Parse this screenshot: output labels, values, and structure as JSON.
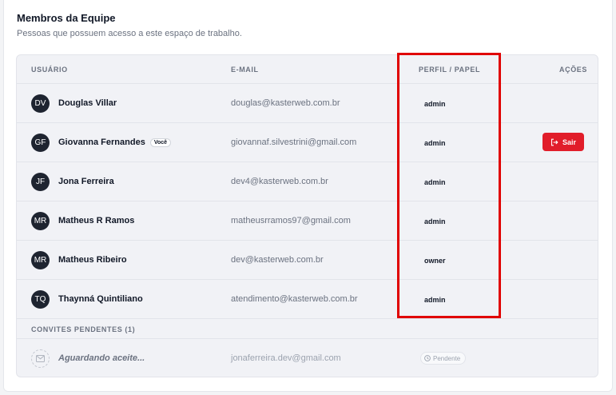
{
  "section": {
    "title": "Membros da Equipe",
    "subtitle": "Pessoas que possuem acesso a este espaço de trabalho."
  },
  "table": {
    "headers": {
      "user": "USUÁRIO",
      "email": "E-MAIL",
      "role": "PERFIL / PAPEL",
      "actions": "AÇÕES"
    },
    "members": [
      {
        "initials": "DV",
        "name": "Douglas Villar",
        "email": "douglas@kasterweb.com.br",
        "role": "admin"
      },
      {
        "initials": "GF",
        "name": "Giovanna Fernandes",
        "badge": "Você",
        "email": "giovannaf.silvestrini@gmail.com",
        "role": "admin",
        "action": "Sair"
      },
      {
        "initials": "JF",
        "name": "Jona Ferreira",
        "email": "dev4@kasterweb.com.br",
        "role": "admin"
      },
      {
        "initials": "MR",
        "name": "Matheus R Ramos",
        "email": "matheusrramos97@gmail.com",
        "role": "admin"
      },
      {
        "initials": "MR",
        "name": "Matheus Ribeiro",
        "email": "dev@kasterweb.com.br",
        "role": "owner"
      },
      {
        "initials": "TQ",
        "name": "Thaynná Quintiliano",
        "email": "atendimento@kasterweb.com.br",
        "role": "admin"
      }
    ],
    "pending": {
      "header": "CONVITES PENDENTES (1)",
      "invites": [
        {
          "label": "Aguardando aceite...",
          "email": "jonaferreira.dev@gmail.com",
          "status": "Pendente",
          "icon": "mail-icon"
        }
      ]
    }
  },
  "colors": {
    "avatar_bg": "#1e2430",
    "danger": "#e11d2a",
    "highlight": "#e00000"
  }
}
